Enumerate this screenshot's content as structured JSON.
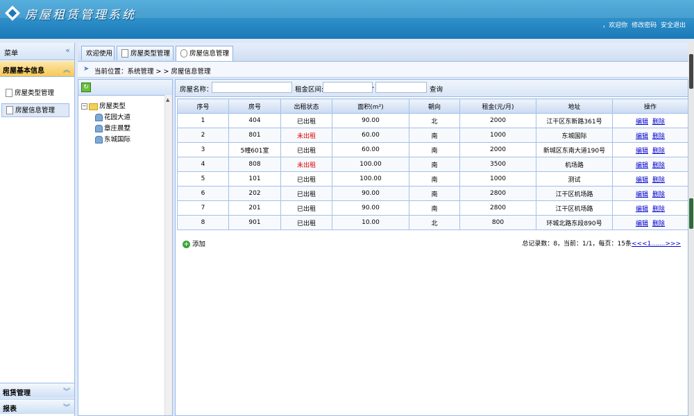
{
  "header": {
    "title": "房屋租赁管理系统",
    "links": [
      "，欢迎你",
      "修改密码",
      "安全退出"
    ]
  },
  "left_panel": {
    "title": "菜单",
    "sections": [
      {
        "title": "房屋基本信息",
        "active": true,
        "items": [
          {
            "label": "房屋类型管理",
            "selected": false
          },
          {
            "label": "房屋信息管理",
            "selected": true
          }
        ]
      },
      {
        "title": "租赁管理",
        "active": false,
        "items": []
      },
      {
        "title": "报表",
        "active": false,
        "items": []
      }
    ]
  },
  "tabs": [
    {
      "label": "欢迎使用",
      "closable": false,
      "active": false
    },
    {
      "label": "房屋类型管理",
      "closable": true,
      "active": false
    },
    {
      "label": "房屋信息管理",
      "closable": true,
      "active": true
    }
  ],
  "tab_close_glyph": "×",
  "breadcrumb": "当前位置：系统管理 > > 房屋信息管理",
  "tree": {
    "root": "房屋类型",
    "children": [
      "花园大道",
      "章庄晨墅",
      "东城国际"
    ]
  },
  "search": {
    "name_label": "房屋名称：",
    "name_value": "",
    "rent_label": "租金区间:",
    "rent_min": "",
    "rent_separator": "-",
    "rent_max": "",
    "query_label": "查询"
  },
  "table": {
    "columns": [
      "序号",
      "房号",
      "出租状态",
      "面积(m²)",
      "朝向",
      "租金(元/月)",
      "地址",
      "操作"
    ],
    "edit_label": "编辑",
    "delete_label": "删除",
    "rows": [
      {
        "no": "1",
        "room": "404",
        "status": "已出租",
        "rented": true,
        "area": "90.00",
        "facing": "北",
        "rent": "2000",
        "address": "江干区东新路361号"
      },
      {
        "no": "2",
        "room": "801",
        "status": "未出租",
        "rented": false,
        "area": "60.00",
        "facing": "南",
        "rent": "1000",
        "address": "东城国际"
      },
      {
        "no": "3",
        "room": "5幢601室",
        "status": "已出租",
        "rented": true,
        "area": "60.00",
        "facing": "南",
        "rent": "2000",
        "address": "新城区东南大道190号"
      },
      {
        "no": "4",
        "room": "808",
        "status": "未出租",
        "rented": false,
        "area": "100.00",
        "facing": "南",
        "rent": "3500",
        "address": "机场路"
      },
      {
        "no": "5",
        "room": "101",
        "status": "已出租",
        "rented": true,
        "area": "100.00",
        "facing": "南",
        "rent": "1000",
        "address": "测试"
      },
      {
        "no": "6",
        "room": "202",
        "status": "已出租",
        "rented": true,
        "area": "90.00",
        "facing": "南",
        "rent": "2800",
        "address": "江干区机场路"
      },
      {
        "no": "7",
        "room": "201",
        "status": "已出租",
        "rented": true,
        "area": "90.00",
        "facing": "南",
        "rent": "2800",
        "address": "江干区机场路"
      },
      {
        "no": "8",
        "room": "901",
        "status": "已出租",
        "rented": true,
        "area": "10.00",
        "facing": "北",
        "rent": "800",
        "address": "环城北路东段890号"
      }
    ]
  },
  "add_label": "添加",
  "pager": {
    "summary": "总记录数：8，当前：1/1，每页：15条",
    "links": "<<<1.......>>>"
  },
  "colors": {
    "header": "#1b79b8",
    "accent": "#99bbe8",
    "unrented": "#e00000",
    "link": "#0000cc"
  }
}
